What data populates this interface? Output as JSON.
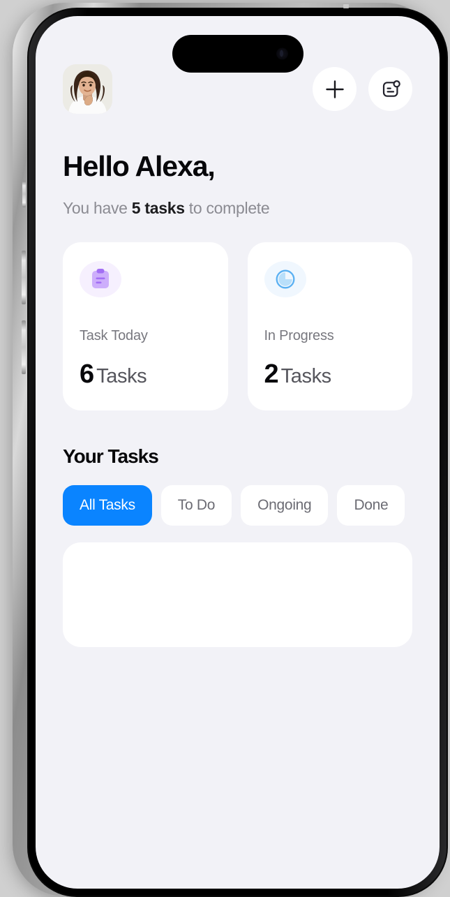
{
  "device": {
    "type": "smartphone-mockup",
    "frame_color": "#b9b9b9",
    "screen_bg": "#f2f2f7"
  },
  "topbar": {
    "avatar_alt": "User profile photo",
    "add_button_label": "+",
    "add_icon": "plus-icon",
    "notifications_icon": "note-badge-icon"
  },
  "header": {
    "greeting": "Hello Alexa,",
    "subtitle_pre": "You have ",
    "subtitle_highlight": "5 tasks",
    "subtitle_post": " to complete"
  },
  "stats": [
    {
      "icon": "clipboard-icon",
      "icon_color": "#b388f8",
      "icon_bg": "#f6f0fe",
      "label": "Task Today",
      "count": "6",
      "unit": "Tasks"
    },
    {
      "icon": "pie-progress-icon",
      "icon_color": "#5ab0f2",
      "icon_bg": "#f0f7fe",
      "label": "In Progress",
      "count": "2",
      "unit": "Tasks"
    }
  ],
  "tasks_section": {
    "title": "Your Tasks",
    "accent_color": "#0a84ff",
    "tabs": [
      {
        "label": "All Tasks",
        "active": true
      },
      {
        "label": "To Do",
        "active": false
      },
      {
        "label": "Ongoing",
        "active": false
      },
      {
        "label": "Done",
        "active": false
      }
    ]
  }
}
